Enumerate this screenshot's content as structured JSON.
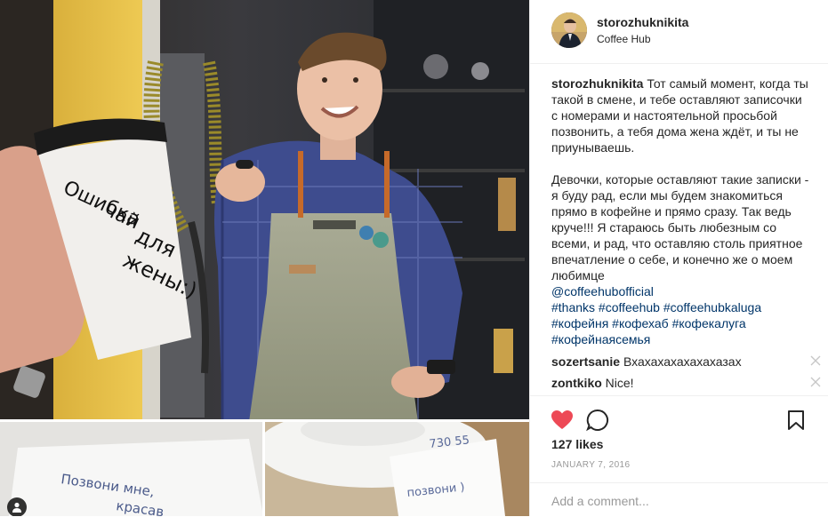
{
  "post": {
    "username": "storozhuknikita",
    "location": "Coffee Hub",
    "caption": {
      "author": "storozhuknikita",
      "paragraph1": "Тот самый момент, когда ты такой в смене, и тебе оставляют записочки с номерами и настоятельной просьбой позвонить, а тебя дома жена ждёт, и ты не приунываешь.",
      "paragraph2": "Девочки, которые оставляют такие записки - я буду рад, если мы будем знакомиться прямо в кофейне и прямо сразу. Так ведь круче!!! Я стараюсь быть любезным со всеми, и рад, что оставляю столь приятное впечатление о себе, и конечно же о моем любимце",
      "mention": "@coffeehubofficial",
      "tags_line1": "#thanks #coffeehub #coffeehubkaluga",
      "tags_line2": "#кофейня #кофехаб #кофекалуга",
      "tags_line3": "#кофейнаясемья"
    },
    "comments": [
      {
        "user": "sozertsanie",
        "text": "Вхахахахахахахазах"
      },
      {
        "user": "zontkiko",
        "text": "Nice!"
      }
    ],
    "likes": "127 likes",
    "date": "JANUARY 7, 2016",
    "add_comment_placeholder": "Add a comment...",
    "photo": {
      "cup_text": [
        "Ошибка",
        "чай",
        "для",
        "жены:)"
      ],
      "note_left": [
        "Позвони мне,",
        "красав"
      ],
      "note_right": [
        "730 55",
        "позвони )"
      ]
    }
  },
  "colors": {
    "heart": "#ed4956",
    "link": "#003569",
    "text": "#262626",
    "muted": "#999999"
  },
  "icons": [
    "heart-icon",
    "comment-icon",
    "bookmark-icon",
    "close-icon",
    "user-tag-icon"
  ]
}
